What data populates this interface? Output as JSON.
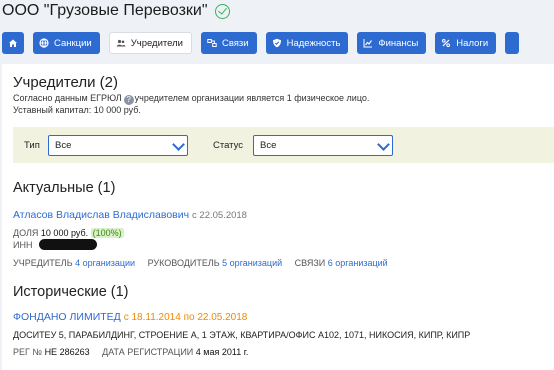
{
  "header": {
    "title": "ООО \"Грузовые Перевозки\""
  },
  "nav": {
    "items": [
      {
        "label": "Санкции",
        "icon": "globe-icon"
      },
      {
        "label": "Учредители",
        "icon": "people-icon",
        "active": true
      },
      {
        "label": "Связи",
        "icon": "links-icon"
      },
      {
        "label": "Надежность",
        "icon": "shield-icon"
      },
      {
        "label": "Финансы",
        "icon": "chart-icon"
      },
      {
        "label": "Налоги",
        "icon": "percent-icon"
      }
    ]
  },
  "founders": {
    "title": "Учредители (2)",
    "info_prefix": "Согласно данным ЕГРЮЛ",
    "info_suffix": "учредителем организации является 1 физическое лицо.",
    "capital": "Уставный капитал: 10 000 руб."
  },
  "filter": {
    "type_label": "Тип",
    "type_value": "Все",
    "status_label": "Статус",
    "status_value": "Все"
  },
  "current": {
    "title": "Актуальные (1)",
    "person": {
      "name": "Атласов Владислав Владиславович",
      "since": "с 22.05.2018",
      "share_label": "ДОЛЯ",
      "share_value": "10 000 руб.",
      "share_pct": "(100%)",
      "inn_label": "ИНН",
      "founder_label": "УЧРЕДИТЕЛЬ",
      "founder_link": "4 организации",
      "director_label": "РУКОВОДИТЕЛЬ",
      "director_link": "5 организаций",
      "links_label": "СВЯЗИ",
      "links_link": "6 организаций"
    }
  },
  "historical": {
    "title": "Исторические (1)",
    "org": {
      "name": "ФОНДАНО ЛИМИТЕД",
      "period": "с 18.11.2014 по 22.05.2018",
      "address": "ДОСИТЕУ 5, ПАРАБИЛДИНГ, СТРОЕНИЕ А, 1 ЭТАЖ, КВАРТИРА/ОФИС А102, 1071, НИКОСИЯ, КИПР, КИПР",
      "reg_label": "РЕГ №",
      "reg_value": "НЕ 286263",
      "date_label": "ДАТА РЕГИСТРАЦИИ",
      "date_value": "4 мая 2011 г."
    }
  },
  "colors": {
    "accent": "#2e6bd1",
    "success": "#35b35a",
    "warning": "#f08a00",
    "filter_bg": "#f2f2e1"
  }
}
